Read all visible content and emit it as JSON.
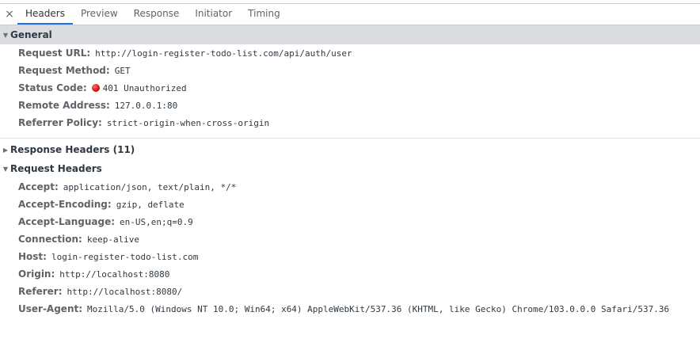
{
  "tabs": [
    {
      "label": "Headers"
    },
    {
      "label": "Preview"
    },
    {
      "label": "Response"
    },
    {
      "label": "Initiator"
    },
    {
      "label": "Timing"
    }
  ],
  "close_glyph": "×",
  "general": {
    "title": "General",
    "rows": [
      {
        "key": "Request URL:",
        "value": "http://login-register-todo-list.com/api/auth/user"
      },
      {
        "key": "Request Method:",
        "value": "GET"
      },
      {
        "key": "Status Code:",
        "value": "401 Unauthorized"
      },
      {
        "key": "Remote Address:",
        "value": "127.0.0.1:80"
      },
      {
        "key": "Referrer Policy:",
        "value": "strict-origin-when-cross-origin"
      }
    ]
  },
  "response_headers": {
    "title": "Response Headers (11)"
  },
  "request_headers": {
    "title": "Request Headers",
    "rows": [
      {
        "key": "Accept:",
        "value": "application/json, text/plain, */*"
      },
      {
        "key": "Accept-Encoding:",
        "value": "gzip, deflate"
      },
      {
        "key": "Accept-Language:",
        "value": "en-US,en;q=0.9"
      },
      {
        "key": "Connection:",
        "value": "keep-alive"
      },
      {
        "key": "Host:",
        "value": "login-register-todo-list.com"
      },
      {
        "key": "Origin:",
        "value": "http://localhost:8080"
      },
      {
        "key": "Referer:",
        "value": "http://localhost:8080/"
      },
      {
        "key": "User-Agent:",
        "value": "Mozilla/5.0 (Windows NT 10.0; Win64; x64) AppleWebKit/537.36 (KHTML, like Gecko) Chrome/103.0.0.0 Safari/537.36"
      }
    ]
  },
  "colors": {
    "accent": "#1a73e8",
    "status_error": "#d00000"
  }
}
